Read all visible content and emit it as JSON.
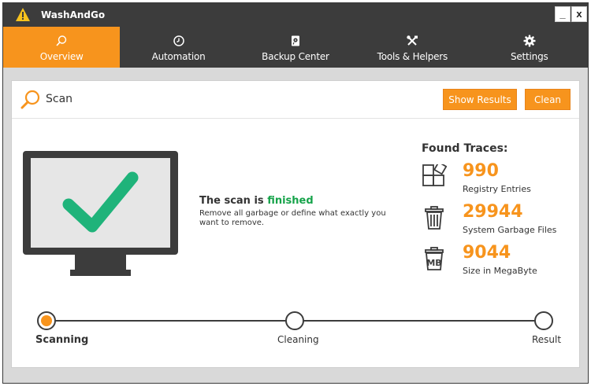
{
  "window": {
    "title": "WashAndGo",
    "minimize_glyph": "_",
    "close_glyph": "x"
  },
  "nav": {
    "items": [
      {
        "label": "Overview",
        "icon": "search-icon",
        "active": true
      },
      {
        "label": "Automation",
        "icon": "clock-icon",
        "active": false
      },
      {
        "label": "Backup Center",
        "icon": "backup-icon",
        "active": false
      },
      {
        "label": "Tools & Helpers",
        "icon": "tools-icon",
        "active": false
      },
      {
        "label": "Settings",
        "icon": "gear-icon",
        "active": false
      }
    ]
  },
  "scan": {
    "title": "Scan",
    "show_results_label": "Show Results",
    "clean_label": "Clean"
  },
  "message": {
    "headline_prefix": "The scan is ",
    "headline_highlight": "finished",
    "subtext": "Remove all garbage or define what exactly you want to remove."
  },
  "traces": {
    "title": "Found Traces:",
    "items": [
      {
        "value": "990",
        "label": "Registry Entries",
        "icon": "registry-icon"
      },
      {
        "value": "29944",
        "label": "System Garbage Files",
        "icon": "trash-icon"
      },
      {
        "value": "9044",
        "label": "Size in MegaByte",
        "icon": "mb-trash-icon"
      }
    ]
  },
  "progress": {
    "steps": [
      {
        "label": "Scanning",
        "state": "current"
      },
      {
        "label": "Cleaning",
        "state": "pending"
      },
      {
        "label": "Result",
        "state": "pending"
      }
    ]
  },
  "colors": {
    "accent": "#f7941d",
    "dark": "#3c3c3c",
    "success": "#16a34a",
    "check": "#1fb37a"
  }
}
